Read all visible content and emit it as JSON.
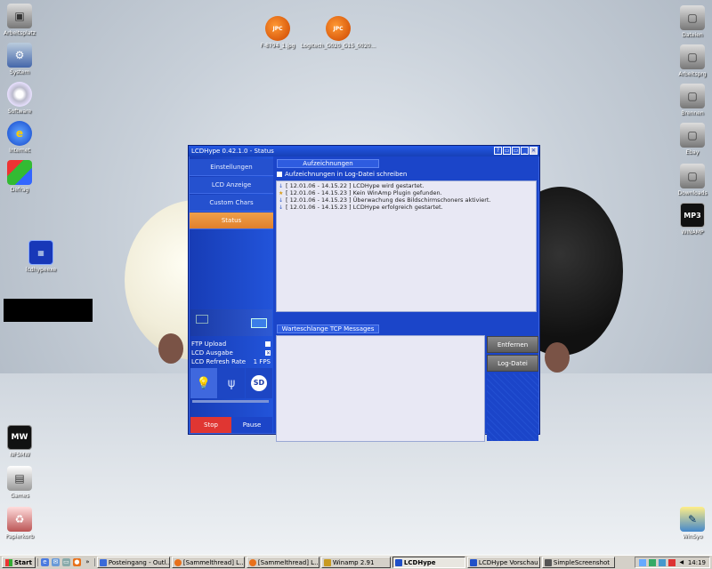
{
  "desktop": {
    "left_icons": [
      {
        "label": "Arbeitsplatz",
        "icon": "computer-icon"
      },
      {
        "label": "System",
        "icon": "system-icon"
      },
      {
        "label": "Software",
        "icon": "cd-icon"
      },
      {
        "label": "Internet",
        "icon": "internet-explorer-icon"
      },
      {
        "label": "Defrag",
        "icon": "defrag-icon"
      },
      {
        "label": "lcdhypeexe",
        "icon": "lcd-app-icon"
      },
      {
        "label": "NFSMW",
        "icon": "nfsmw-icon"
      },
      {
        "label": "Games",
        "icon": "games-icon"
      },
      {
        "label": "Papierkorb",
        "icon": "recycle-bin-icon"
      }
    ],
    "top_files": [
      {
        "label": "F-8794_1.jpg",
        "badge": "JPC"
      },
      {
        "label": "Logitech_G020_G15_0020...",
        "badge": "JPC"
      }
    ],
    "right_icons": [
      {
        "label": "Dateien",
        "icon": "folder-icon"
      },
      {
        "label": "Arbeitsprg",
        "icon": "folder-icon"
      },
      {
        "label": "Brennen",
        "icon": "folder-icon"
      },
      {
        "label": "Ebay",
        "icon": "folder-icon"
      },
      {
        "label": "Downloads",
        "icon": "folder-icon"
      },
      {
        "label": "WINAMP",
        "icon": "mp3-icon",
        "glyph": "MP3"
      },
      {
        "label": "WinSyo",
        "icon": "winsyo-icon"
      }
    ]
  },
  "app": {
    "title": "LCDHype 0.42.1.0 - Status",
    "title_buttons": [
      "?",
      "▭",
      "▭",
      "_",
      "✕"
    ],
    "nav": [
      {
        "label": "Einstellungen",
        "active": false
      },
      {
        "label": "LCD Anzeige",
        "active": false
      },
      {
        "label": "Custom Chars",
        "active": false
      },
      {
        "label": "Status",
        "active": true
      }
    ],
    "options": [
      {
        "label": "FTP Upload",
        "value": "",
        "checked": false
      },
      {
        "label": "LCD Ausgabe",
        "value": "✕",
        "checked": true
      },
      {
        "label": "LCD Refresh Rate",
        "value": "1 FPS"
      }
    ],
    "icon_buttons": [
      "bulb-on-icon",
      "bulb-icon",
      "sd-icon"
    ],
    "sd_label": "SD",
    "stop_label": "Stop",
    "pause_label": "Pause",
    "log_section": {
      "header": "Aufzeichnungen",
      "checkbox_label": "Aufzeichnungen in Log-Datei schreiben",
      "entries": [
        {
          "time": "[ 12.01.06 - 14.15.22 ]",
          "message": "LCDHype wird gestartet.",
          "type": "info"
        },
        {
          "time": "[ 12.01.06 - 14.15.23 ]",
          "message": "Kein WinAmp Plugin gefunden.",
          "type": "warn"
        },
        {
          "time": "[ 12.01.06 - 14.15.23 ]",
          "message": "Überwachung des Bildschirmschoners aktiviert.",
          "type": "info"
        },
        {
          "time": "[ 12.01.06 - 14.15.23 ]",
          "message": "LCDHype erfolgreich gestartet.",
          "type": "info"
        }
      ]
    },
    "tcp_section": {
      "header": "Warteschlange TCP Messages",
      "remove_label": "Entfernen",
      "logfile_label": "Log-Datei"
    }
  },
  "taskbar": {
    "start_label": "Start",
    "tasks": [
      {
        "label": "Posteingang - Outl...",
        "active": false,
        "color": "#3a6ad8"
      },
      {
        "label": "[Sammelthread] L...",
        "active": false,
        "color": "#e8701a"
      },
      {
        "label": "[Sammelthread] L...",
        "active": false,
        "color": "#e8701a"
      },
      {
        "label": "Winamp 2.91",
        "active": false,
        "color": "#c89a20"
      },
      {
        "label": "LCDHype",
        "active": true,
        "color": "#2050c8"
      },
      {
        "label": "LCDHype Vorschau",
        "active": false,
        "color": "#2050c8"
      },
      {
        "label": "SimpleScreenshot",
        "active": false,
        "color": "#555555"
      }
    ],
    "clock": "14:19"
  }
}
